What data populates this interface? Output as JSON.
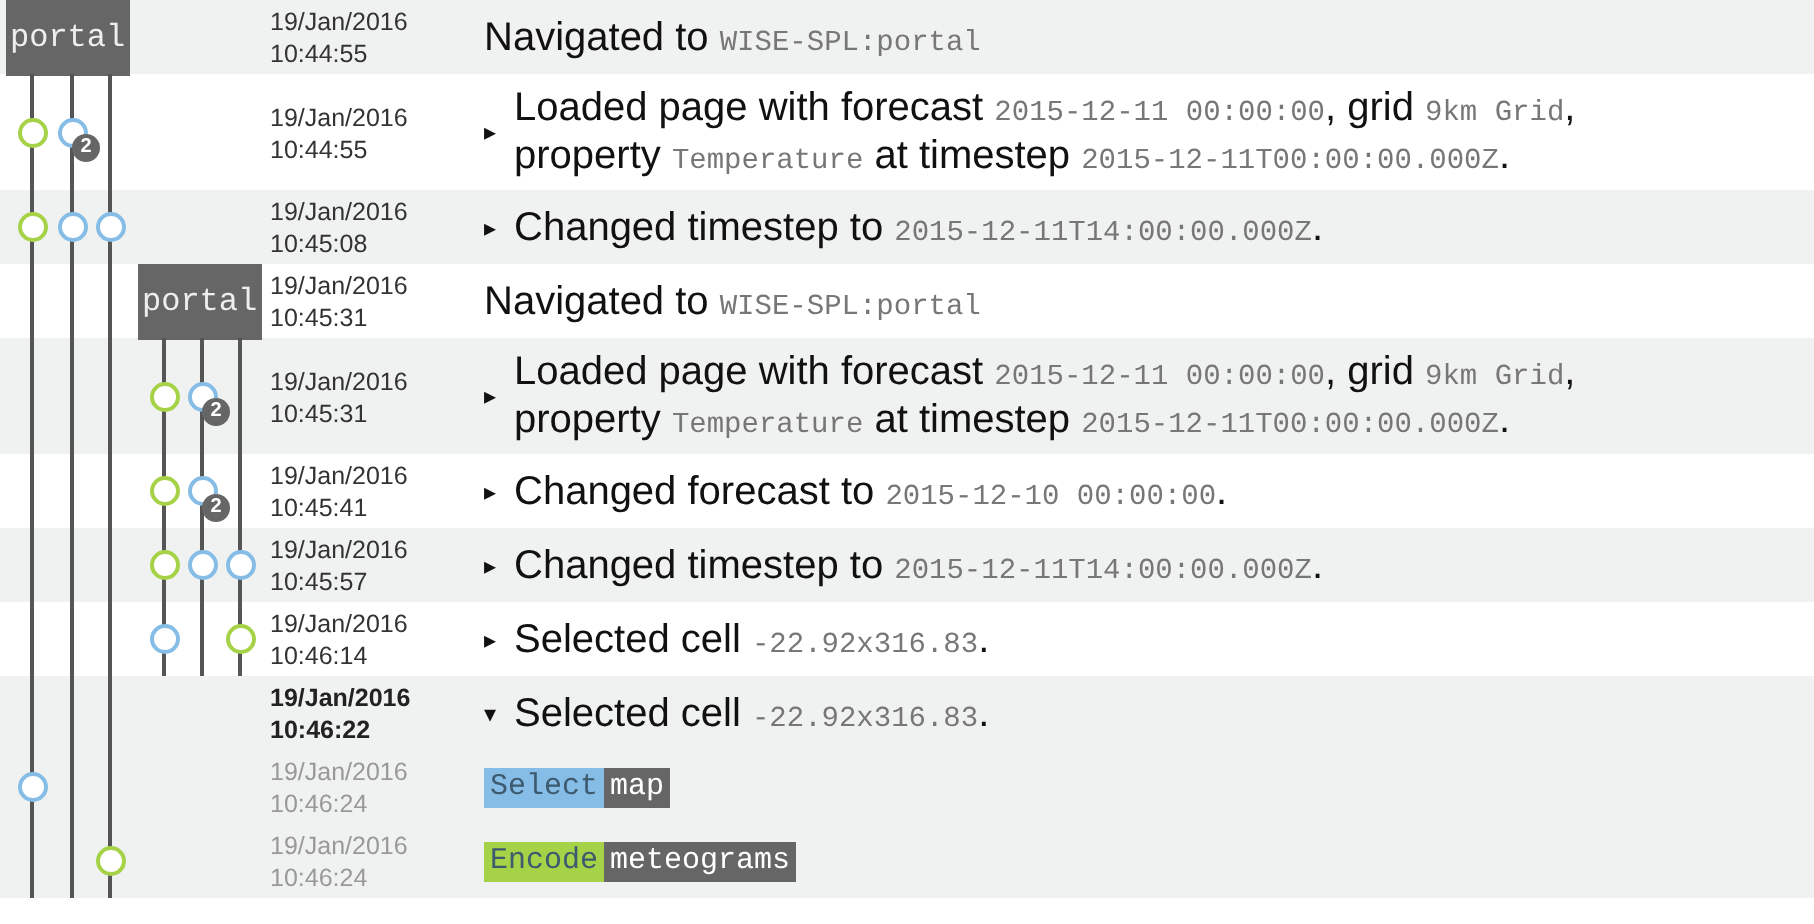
{
  "rows": [
    {
      "label": "portal",
      "time": "19/Jan/2016 10:44:55",
      "slots": [
        {
          "kind": "none"
        },
        {
          "kind": "none"
        },
        {
          "kind": "none"
        }
      ],
      "message": [
        {
          "kind": "plain",
          "text": "Navigated to "
        },
        {
          "kind": "code",
          "text": "WISE-SPL:portal"
        }
      ]
    },
    {
      "time": "19/Jan/2016 10:44:55",
      "toggle": "▸",
      "slots": [
        {
          "kind": "node",
          "color": "#a6d247"
        },
        {
          "kind": "node",
          "color": "#86bde6",
          "badge": "2"
        },
        {
          "kind": "none"
        }
      ],
      "message": [
        {
          "kind": "plain",
          "text": "Loaded page with forecast "
        },
        {
          "kind": "code",
          "text": "2015-12-11 00:00:00"
        },
        {
          "kind": "plain",
          "text": ", grid "
        },
        {
          "kind": "code",
          "text": "9km Grid"
        },
        {
          "kind": "plain",
          "text": ", property "
        },
        {
          "kind": "code",
          "text": "Temperature"
        },
        {
          "kind": "plain",
          "text": " at timestep "
        },
        {
          "kind": "code",
          "text": "2015-12-11T00:00:00.000Z"
        },
        {
          "kind": "plain",
          "text": "."
        }
      ]
    },
    {
      "time": "19/Jan/2016 10:45:08",
      "toggle": "▸",
      "slots": [
        {
          "kind": "node",
          "color": "#a6d247"
        },
        {
          "kind": "node",
          "color": "#86bde6"
        },
        {
          "kind": "node",
          "color": "#86bde6"
        }
      ],
      "message": [
        {
          "kind": "plain",
          "text": "Changed timestep to "
        },
        {
          "kind": "code",
          "text": "2015-12-11T14:00:00.000Z"
        },
        {
          "kind": "plain",
          "text": "."
        }
      ]
    },
    {
      "nested": true,
      "label": "portal",
      "time": "19/Jan/2016 10:45:31",
      "slots": [
        {
          "kind": "none"
        },
        {
          "kind": "none"
        },
        {
          "kind": "none"
        }
      ],
      "message": [
        {
          "kind": "plain",
          "text": "Navigated to "
        },
        {
          "kind": "code",
          "text": "WISE-SPL:portal"
        }
      ]
    },
    {
      "nested": true,
      "time": "19/Jan/2016 10:45:31",
      "toggle": "▸",
      "slots": [
        {
          "kind": "node",
          "color": "#a6d247"
        },
        {
          "kind": "node",
          "color": "#86bde6",
          "badge": "2"
        },
        {
          "kind": "none"
        }
      ],
      "message": [
        {
          "kind": "plain",
          "text": "Loaded page with forecast "
        },
        {
          "kind": "code",
          "text": "2015-12-11 00:00:00"
        },
        {
          "kind": "plain",
          "text": ", grid "
        },
        {
          "kind": "code",
          "text": "9km Grid"
        },
        {
          "kind": "plain",
          "text": ", property "
        },
        {
          "kind": "code",
          "text": "Temperature"
        },
        {
          "kind": "plain",
          "text": " at timestep "
        },
        {
          "kind": "code",
          "text": "2015-12-11T00:00:00.000Z"
        },
        {
          "kind": "plain",
          "text": "."
        }
      ]
    },
    {
      "nested": true,
      "time": "19/Jan/2016 10:45:41",
      "toggle": "▸",
      "slots": [
        {
          "kind": "node",
          "color": "#a6d247"
        },
        {
          "kind": "node",
          "color": "#86bde6",
          "badge": "2"
        },
        {
          "kind": "none"
        }
      ],
      "message": [
        {
          "kind": "plain",
          "text": "Changed forecast to "
        },
        {
          "kind": "code",
          "text": "2015-12-10 00:00:00"
        },
        {
          "kind": "plain",
          "text": "."
        }
      ]
    },
    {
      "nested": true,
      "time": "19/Jan/2016 10:45:57",
      "toggle": "▸",
      "slots": [
        {
          "kind": "node",
          "color": "#a6d247"
        },
        {
          "kind": "node",
          "color": "#86bde6"
        },
        {
          "kind": "node",
          "color": "#86bde6"
        }
      ],
      "message": [
        {
          "kind": "plain",
          "text": "Changed timestep to "
        },
        {
          "kind": "code",
          "text": "2015-12-11T14:00:00.000Z"
        },
        {
          "kind": "plain",
          "text": "."
        }
      ]
    },
    {
      "nested": true,
      "time": "19/Jan/2016 10:46:14",
      "toggle": "▸",
      "slots": [
        {
          "kind": "node",
          "color": "#86bde6"
        },
        {
          "kind": "none"
        },
        {
          "kind": "node",
          "color": "#a6d247"
        }
      ],
      "message": [
        {
          "kind": "plain",
          "text": "Selected cell "
        },
        {
          "kind": "code",
          "text": "-22.92x316.83"
        },
        {
          "kind": "plain",
          "text": "."
        }
      ]
    },
    {
      "time": "19/Jan/2016 10:46:22",
      "bold": true,
      "toggle": "▾",
      "slots": [
        {
          "kind": "none"
        },
        {
          "kind": "none"
        },
        {
          "kind": "none"
        }
      ],
      "message": [
        {
          "kind": "plain",
          "text": "Selected cell "
        },
        {
          "kind": "code",
          "text": "-22.92x316.83"
        },
        {
          "kind": "plain",
          "text": "."
        }
      ],
      "children": [
        {
          "time": "19/Jan/2016 10:46:24",
          "muted": true,
          "slots": [
            {
              "kind": "node",
              "color": "#86bde6"
            },
            {
              "kind": "none"
            },
            {
              "kind": "none"
            }
          ],
          "tag": {
            "action": "Select",
            "target": "map",
            "color": "#86bde6"
          }
        },
        {
          "time": "19/Jan/2016 10:46:24",
          "muted": true,
          "slots": [
            {
              "kind": "none"
            },
            {
              "kind": "none"
            },
            {
              "kind": "node",
              "color": "#a6d247"
            }
          ],
          "tag": {
            "action": "Encode",
            "target": "meteograms",
            "color": "#a6d247"
          }
        }
      ]
    }
  ]
}
